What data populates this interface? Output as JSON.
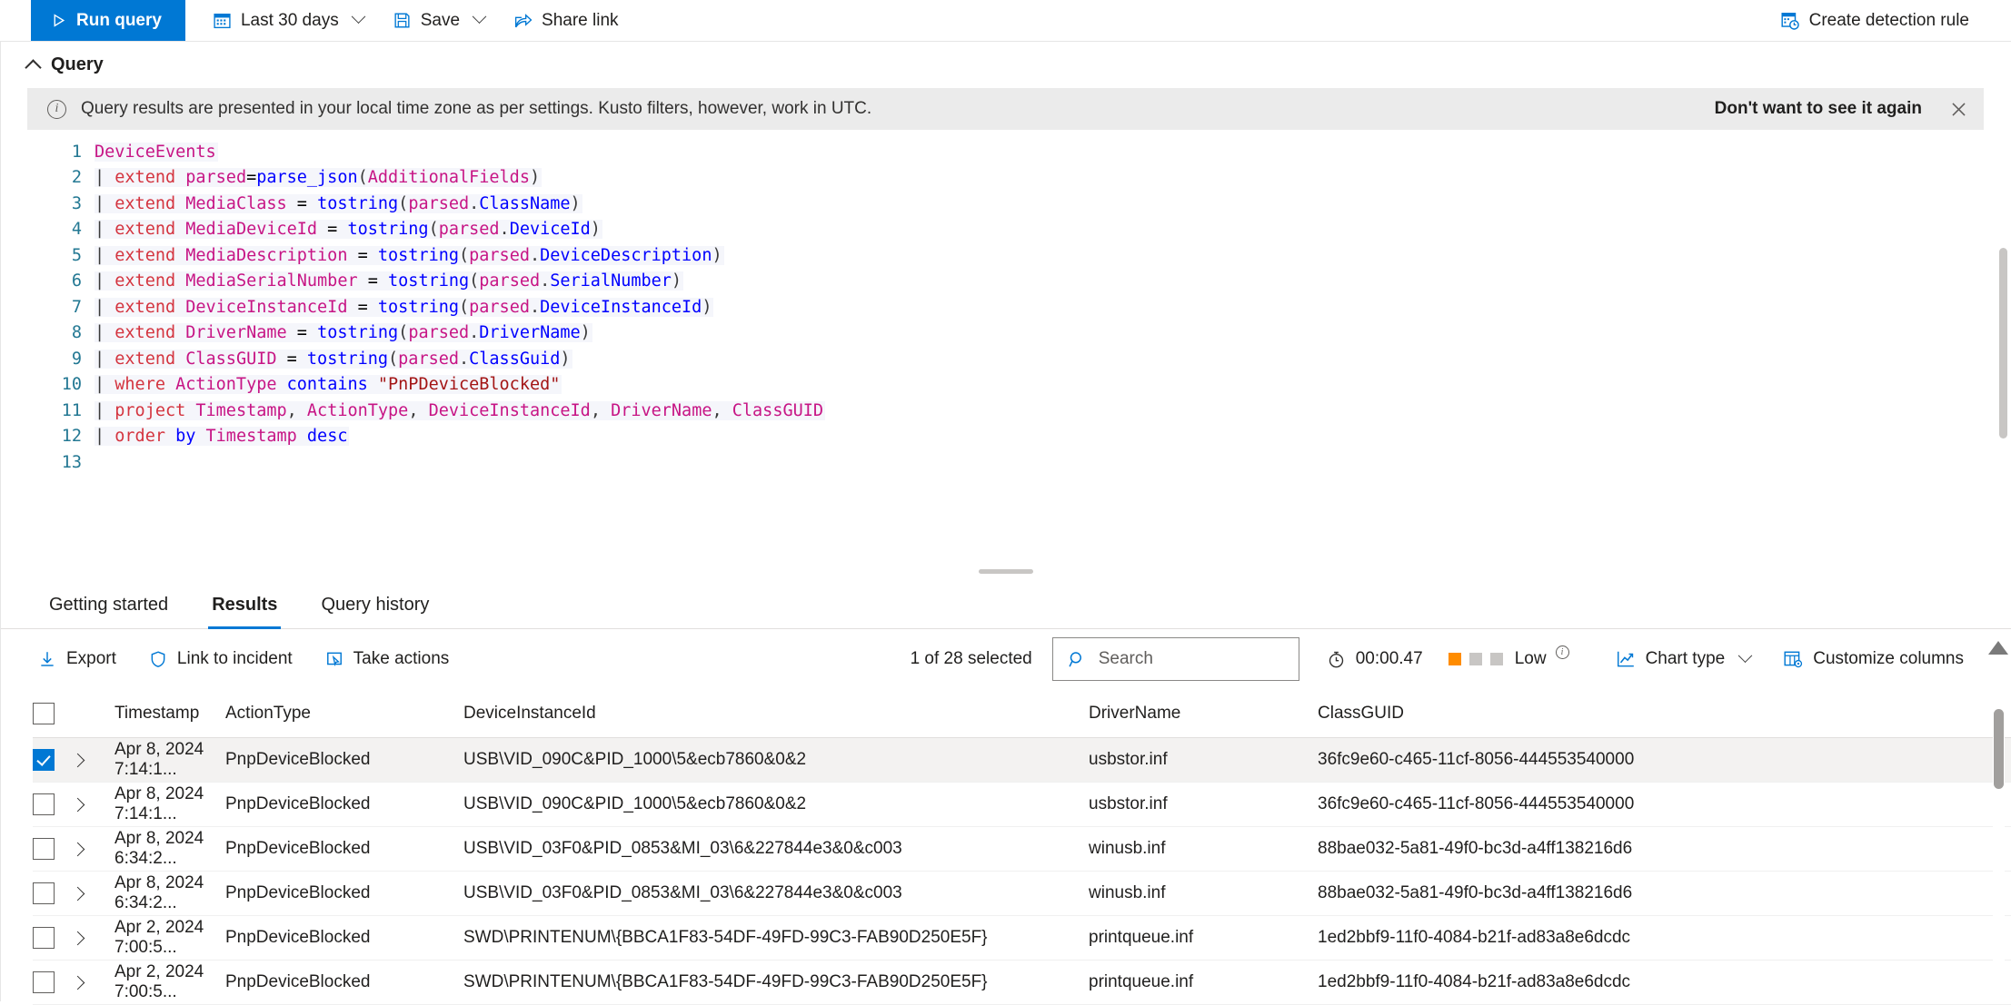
{
  "toolbar": {
    "run_query": "Run query",
    "time_range": "Last 30 days",
    "save": "Save",
    "share_link": "Share link",
    "create_detection_rule": "Create detection rule"
  },
  "query_section": {
    "title": "Query",
    "banner": {
      "message": "Query results are presented in your local time zone as per settings. Kusto filters, however, work in UTC.",
      "dismiss_label": "Don't want to see it again",
      "close_label": "×"
    }
  },
  "code": {
    "lines": [
      {
        "n": "1",
        "tokens": [
          {
            "t": "DeviceEvents",
            "c": "tbl"
          }
        ]
      },
      {
        "n": "2",
        "tokens": [
          {
            "t": "| ",
            "c": "punc"
          },
          {
            "t": "extend ",
            "c": "kw"
          },
          {
            "t": "parsed",
            "c": "col"
          },
          {
            "t": "=",
            "c": "op"
          },
          {
            "t": "parse_json",
            "c": "fn"
          },
          {
            "t": "(",
            "c": "punc"
          },
          {
            "t": "AdditionalFields",
            "c": "col"
          },
          {
            "t": ")",
            "c": "punc"
          }
        ]
      },
      {
        "n": "3",
        "tokens": [
          {
            "t": "| ",
            "c": "punc"
          },
          {
            "t": "extend ",
            "c": "kw"
          },
          {
            "t": "MediaClass",
            "c": "col"
          },
          {
            "t": " = ",
            "c": "op"
          },
          {
            "t": "tostring",
            "c": "fn"
          },
          {
            "t": "(",
            "c": "punc"
          },
          {
            "t": "parsed",
            "c": "col"
          },
          {
            "t": ".",
            "c": "punc"
          },
          {
            "t": "ClassName",
            "c": "fn"
          },
          {
            "t": ")",
            "c": "punc"
          }
        ]
      },
      {
        "n": "4",
        "tokens": [
          {
            "t": "| ",
            "c": "punc"
          },
          {
            "t": "extend ",
            "c": "kw"
          },
          {
            "t": "MediaDeviceId",
            "c": "col"
          },
          {
            "t": " = ",
            "c": "op"
          },
          {
            "t": "tostring",
            "c": "fn"
          },
          {
            "t": "(",
            "c": "punc"
          },
          {
            "t": "parsed",
            "c": "col"
          },
          {
            "t": ".",
            "c": "punc"
          },
          {
            "t": "DeviceId",
            "c": "fn"
          },
          {
            "t": ")",
            "c": "punc"
          }
        ]
      },
      {
        "n": "5",
        "tokens": [
          {
            "t": "| ",
            "c": "punc"
          },
          {
            "t": "extend ",
            "c": "kw"
          },
          {
            "t": "MediaDescription",
            "c": "col"
          },
          {
            "t": " = ",
            "c": "op"
          },
          {
            "t": "tostring",
            "c": "fn"
          },
          {
            "t": "(",
            "c": "punc"
          },
          {
            "t": "parsed",
            "c": "col"
          },
          {
            "t": ".",
            "c": "punc"
          },
          {
            "t": "DeviceDescription",
            "c": "fn"
          },
          {
            "t": ")",
            "c": "punc"
          }
        ]
      },
      {
        "n": "6",
        "tokens": [
          {
            "t": "| ",
            "c": "punc"
          },
          {
            "t": "extend ",
            "c": "kw"
          },
          {
            "t": "MediaSerialNumber",
            "c": "col"
          },
          {
            "t": " = ",
            "c": "op"
          },
          {
            "t": "tostring",
            "c": "fn"
          },
          {
            "t": "(",
            "c": "punc"
          },
          {
            "t": "parsed",
            "c": "col"
          },
          {
            "t": ".",
            "c": "punc"
          },
          {
            "t": "SerialNumber",
            "c": "fn"
          },
          {
            "t": ")",
            "c": "punc"
          }
        ]
      },
      {
        "n": "7",
        "tokens": [
          {
            "t": "| ",
            "c": "punc"
          },
          {
            "t": "extend ",
            "c": "kw"
          },
          {
            "t": "DeviceInstanceId",
            "c": "col"
          },
          {
            "t": " = ",
            "c": "op"
          },
          {
            "t": "tostring",
            "c": "fn"
          },
          {
            "t": "(",
            "c": "punc"
          },
          {
            "t": "parsed",
            "c": "col"
          },
          {
            "t": ".",
            "c": "punc"
          },
          {
            "t": "DeviceInstanceId",
            "c": "fn"
          },
          {
            "t": ")",
            "c": "punc"
          }
        ]
      },
      {
        "n": "8",
        "tokens": [
          {
            "t": "| ",
            "c": "punc"
          },
          {
            "t": "extend ",
            "c": "kw"
          },
          {
            "t": "DriverName",
            "c": "col"
          },
          {
            "t": " = ",
            "c": "op"
          },
          {
            "t": "tostring",
            "c": "fn"
          },
          {
            "t": "(",
            "c": "punc"
          },
          {
            "t": "parsed",
            "c": "col"
          },
          {
            "t": ".",
            "c": "punc"
          },
          {
            "t": "DriverName",
            "c": "fn"
          },
          {
            "t": ")",
            "c": "punc"
          }
        ]
      },
      {
        "n": "9",
        "tokens": [
          {
            "t": "| ",
            "c": "punc"
          },
          {
            "t": "extend ",
            "c": "kw"
          },
          {
            "t": "ClassGUID",
            "c": "col"
          },
          {
            "t": " = ",
            "c": "op"
          },
          {
            "t": "tostring",
            "c": "fn"
          },
          {
            "t": "(",
            "c": "punc"
          },
          {
            "t": "parsed",
            "c": "col"
          },
          {
            "t": ".",
            "c": "punc"
          },
          {
            "t": "ClassGuid",
            "c": "fn"
          },
          {
            "t": ")",
            "c": "punc"
          }
        ]
      },
      {
        "n": "10",
        "tokens": [
          {
            "t": "| ",
            "c": "punc"
          },
          {
            "t": "where ",
            "c": "kw"
          },
          {
            "t": "ActionType ",
            "c": "col"
          },
          {
            "t": "contains ",
            "c": "fn"
          },
          {
            "t": "\"PnPDeviceBlocked\"",
            "c": "str"
          }
        ]
      },
      {
        "n": "11",
        "tokens": [
          {
            "t": "| ",
            "c": "punc"
          },
          {
            "t": "project ",
            "c": "kw"
          },
          {
            "t": "Timestamp",
            "c": "col"
          },
          {
            "t": ", ",
            "c": "punc"
          },
          {
            "t": "ActionType",
            "c": "col"
          },
          {
            "t": ", ",
            "c": "punc"
          },
          {
            "t": "DeviceInstanceId",
            "c": "col"
          },
          {
            "t": ", ",
            "c": "punc"
          },
          {
            "t": "DriverName",
            "c": "col"
          },
          {
            "t": ", ",
            "c": "punc"
          },
          {
            "t": "ClassGUID",
            "c": "col"
          }
        ]
      },
      {
        "n": "12",
        "tokens": [
          {
            "t": "| ",
            "c": "punc"
          },
          {
            "t": "order ",
            "c": "kw"
          },
          {
            "t": "by ",
            "c": "fn"
          },
          {
            "t": "Timestamp ",
            "c": "col"
          },
          {
            "t": "desc",
            "c": "fn"
          }
        ]
      },
      {
        "n": "13",
        "tokens": []
      }
    ]
  },
  "tabs": [
    {
      "label": "Getting started",
      "active": false
    },
    {
      "label": "Results",
      "active": true
    },
    {
      "label": "Query history",
      "active": false
    }
  ],
  "results_toolbar": {
    "export": "Export",
    "link_to_incident": "Link to incident",
    "take_actions": "Take actions",
    "selected_count": "1 of 28 selected",
    "search_placeholder": "Search",
    "elapsed": "00:00.47",
    "severity": "Low",
    "chart_type": "Chart type",
    "customize_columns": "Customize columns"
  },
  "table": {
    "columns": [
      "Timestamp",
      "ActionType",
      "DeviceInstanceId",
      "DriverName",
      "ClassGUID"
    ],
    "rows": [
      {
        "selected": true,
        "Timestamp": "Apr 8, 2024 7:14:1...",
        "ActionType": "PnpDeviceBlocked",
        "DeviceInstanceId": "USB\\VID_090C&PID_1000\\5&ecb7860&0&2",
        "DriverName": "usbstor.inf",
        "ClassGUID": "36fc9e60-c465-11cf-8056-444553540000"
      },
      {
        "selected": false,
        "Timestamp": "Apr 8, 2024 7:14:1...",
        "ActionType": "PnpDeviceBlocked",
        "DeviceInstanceId": "USB\\VID_090C&PID_1000\\5&ecb7860&0&2",
        "DriverName": "usbstor.inf",
        "ClassGUID": "36fc9e60-c465-11cf-8056-444553540000"
      },
      {
        "selected": false,
        "Timestamp": "Apr 8, 2024 6:34:2...",
        "ActionType": "PnpDeviceBlocked",
        "DeviceInstanceId": "USB\\VID_03F0&PID_0853&MI_03\\6&227844e3&0&c003",
        "DriverName": "winusb.inf",
        "ClassGUID": "88bae032-5a81-49f0-bc3d-a4ff138216d6"
      },
      {
        "selected": false,
        "Timestamp": "Apr 8, 2024 6:34:2...",
        "ActionType": "PnpDeviceBlocked",
        "DeviceInstanceId": "USB\\VID_03F0&PID_0853&MI_03\\6&227844e3&0&c003",
        "DriverName": "winusb.inf",
        "ClassGUID": "88bae032-5a81-49f0-bc3d-a4ff138216d6"
      },
      {
        "selected": false,
        "Timestamp": "Apr 2, 2024 7:00:5...",
        "ActionType": "PnpDeviceBlocked",
        "DeviceInstanceId": "SWD\\PRINTENUM\\{BBCA1F83-54DF-49FD-99C3-FAB90D250E5F}",
        "DriverName": "printqueue.inf",
        "ClassGUID": "1ed2bbf9-11f0-4084-b21f-ad83a8e6dcdc"
      },
      {
        "selected": false,
        "Timestamp": "Apr 2, 2024 7:00:5...",
        "ActionType": "PnpDeviceBlocked",
        "DeviceInstanceId": "SWD\\PRINTENUM\\{BBCA1F83-54DF-49FD-99C3-FAB90D250E5F}",
        "DriverName": "printqueue.inf",
        "ClassGUID": "1ed2bbf9-11f0-4084-b21f-ad83a8e6dcdc"
      }
    ]
  },
  "colors": {
    "accent": "#0078d4",
    "severity_low": "#ff8c00",
    "banner_bg": "#ebebeb"
  }
}
